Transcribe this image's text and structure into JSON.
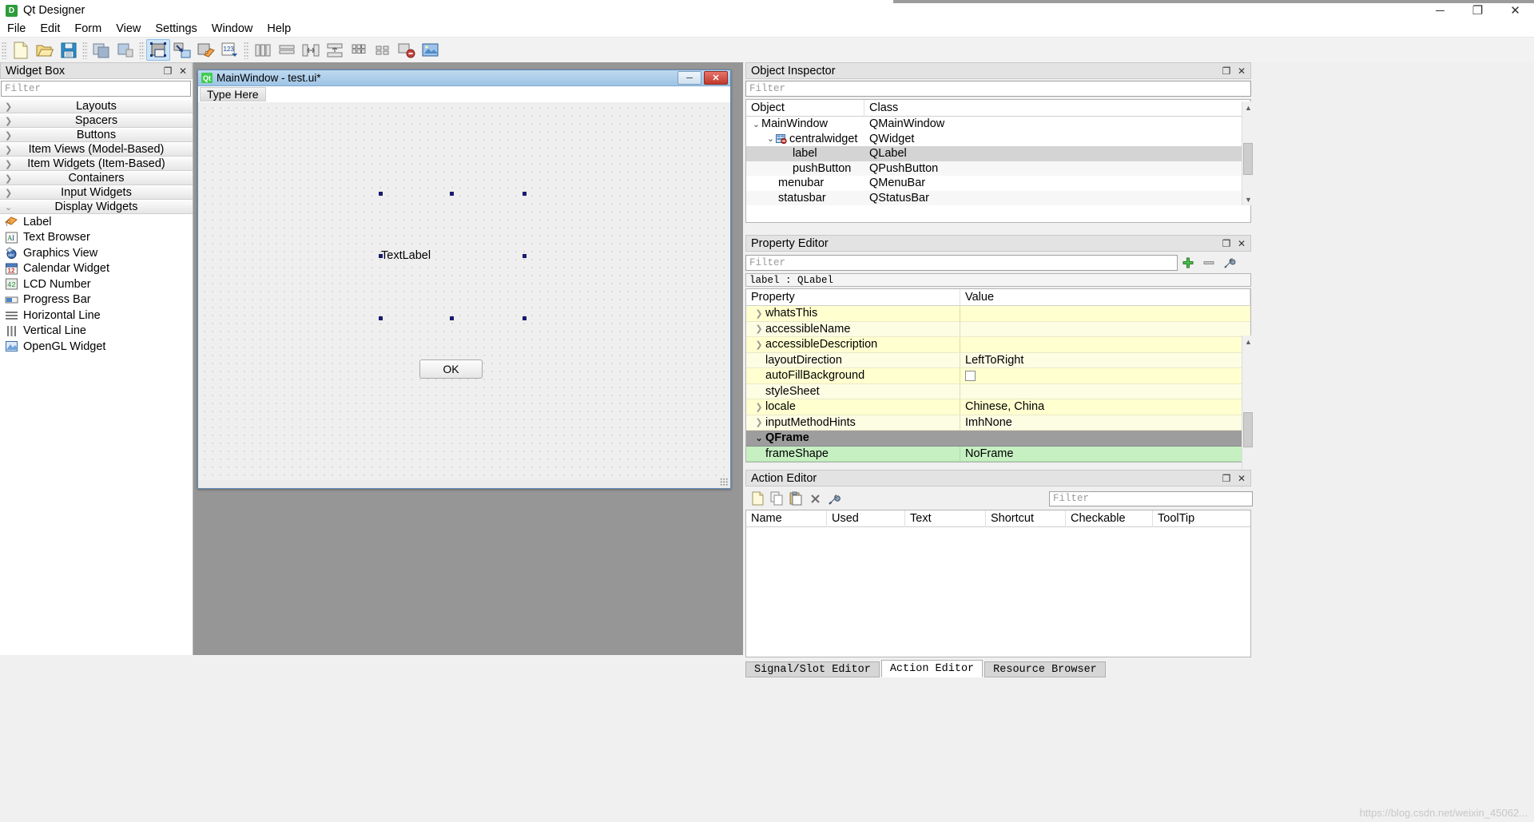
{
  "app": {
    "title": "Qt Designer",
    "icon": "qt-designer-icon",
    "window_buttons": {
      "minimize": "─",
      "maximize": "❐",
      "close": "✕"
    }
  },
  "menubar": {
    "items": [
      "File",
      "Edit",
      "Form",
      "View",
      "Settings",
      "Window",
      "Help"
    ]
  },
  "toolbar": {
    "groups": [
      {
        "name": "file",
        "buttons": [
          {
            "name": "new-form-button",
            "icon": "new-document-icon"
          },
          {
            "name": "open-form-button",
            "icon": "open-folder-icon"
          },
          {
            "name": "save-form-button",
            "icon": "floppy-save-icon"
          }
        ]
      },
      {
        "name": "edit",
        "buttons": [
          {
            "name": "undo-button",
            "icon": "copy-stack-icon"
          },
          {
            "name": "redo-button",
            "icon": "paste-stack-icon"
          }
        ]
      },
      {
        "name": "mode",
        "buttons": [
          {
            "name": "edit-widgets-button",
            "icon": "edit-widgets-icon",
            "active": true
          },
          {
            "name": "edit-signals-slots-button",
            "icon": "signal-slot-icon",
            "active": false
          },
          {
            "name": "edit-buddies-button",
            "icon": "buddy-label-icon",
            "active": false
          },
          {
            "name": "edit-tab-order-button",
            "icon": "tab-order-icon",
            "active": false
          }
        ]
      },
      {
        "name": "layout",
        "buttons": [
          {
            "name": "layout-horizontally-button",
            "icon": "layout-horizontal-icon"
          },
          {
            "name": "layout-vertically-button",
            "icon": "layout-vertical-icon"
          },
          {
            "name": "layout-splitter-h-button",
            "icon": "splitter-horizontal-icon"
          },
          {
            "name": "layout-splitter-v-button",
            "icon": "splitter-vertical-icon"
          },
          {
            "name": "layout-grid-button",
            "icon": "layout-grid-icon"
          },
          {
            "name": "layout-form-button",
            "icon": "layout-form-icon"
          },
          {
            "name": "break-layout-button",
            "icon": "break-layout-icon"
          },
          {
            "name": "adjust-size-button",
            "icon": "adjust-size-icon"
          }
        ]
      }
    ]
  },
  "widget_box": {
    "title": "Widget Box",
    "float_button": "❐",
    "close_button": "✕",
    "filter_placeholder": "Filter",
    "categories": [
      {
        "label": "Layouts",
        "expanded": false
      },
      {
        "label": "Spacers",
        "expanded": false
      },
      {
        "label": "Buttons",
        "expanded": false
      },
      {
        "label": "Item Views (Model-Based)",
        "expanded": false
      },
      {
        "label": "Item Widgets (Item-Based)",
        "expanded": false
      },
      {
        "label": "Containers",
        "expanded": false
      },
      {
        "label": "Input Widgets",
        "expanded": false
      },
      {
        "label": "Display Widgets",
        "expanded": true
      }
    ],
    "items": [
      {
        "label": "Label",
        "icon": "label-tag-icon"
      },
      {
        "label": "Text Browser",
        "icon": "text-browser-icon"
      },
      {
        "label": "Graphics View",
        "icon": "graphics-view-icon"
      },
      {
        "label": "Calendar Widget",
        "icon": "calendar-icon"
      },
      {
        "label": "LCD Number",
        "icon": "lcd-number-icon"
      },
      {
        "label": "Progress Bar",
        "icon": "progress-bar-icon"
      },
      {
        "label": "Horizontal Line",
        "icon": "horizontal-line-icon"
      },
      {
        "label": "Vertical Line",
        "icon": "vertical-line-icon"
      },
      {
        "label": "OpenGL Widget",
        "icon": "opengl-widget-icon"
      }
    ]
  },
  "form_window": {
    "title": "MainWindow - test.ui*",
    "icon": "qt-logo-icon",
    "buttons": {
      "minimize": "─",
      "close": "✕"
    },
    "menu_placeholder": "Type Here",
    "label_text": "TextLabel",
    "button_text": "OK"
  },
  "object_inspector": {
    "title": "Object Inspector",
    "float_button": "❐",
    "close_button": "✕",
    "filter_placeholder": "Filter",
    "columns": [
      "Object",
      "Class"
    ],
    "rows": [
      {
        "object": "MainWindow",
        "class": "QMainWindow",
        "depth": 0,
        "arrow": "⌄",
        "icon": "",
        "selected": false
      },
      {
        "object": "centralwidget",
        "class": "QWidget",
        "depth": 1,
        "arrow": "⌄",
        "icon": "central-widget-icon",
        "selected": false
      },
      {
        "object": "label",
        "class": "QLabel",
        "depth": 2,
        "arrow": "",
        "icon": "",
        "selected": true
      },
      {
        "object": "pushButton",
        "class": "QPushButton",
        "depth": 2,
        "arrow": "",
        "icon": "",
        "selected": false
      },
      {
        "object": "menubar",
        "class": "QMenuBar",
        "depth": 1,
        "arrow": "",
        "icon": "",
        "selected": false
      },
      {
        "object": "statusbar",
        "class": "QStatusBar",
        "depth": 1,
        "arrow": "",
        "icon": "",
        "selected": false
      }
    ]
  },
  "property_editor": {
    "title": "Property Editor",
    "float_button": "❐",
    "close_button": "✕",
    "filter_placeholder": "Filter",
    "add_button": "add-property-icon",
    "remove_button": "remove-property-icon",
    "configure_button": "configure-icon",
    "object_header": "label : QLabel",
    "columns": [
      "Property",
      "Value"
    ],
    "rows": [
      {
        "name": "whatsThis",
        "value": "",
        "expandable": true,
        "style": "y0"
      },
      {
        "name": "accessibleName",
        "value": "",
        "expandable": true,
        "style": "y1"
      },
      {
        "name": "accessibleDescription",
        "value": "",
        "expandable": true,
        "style": "y0"
      },
      {
        "name": "layoutDirection",
        "value": "LeftToRight",
        "expandable": false,
        "style": "y1"
      },
      {
        "name": "autoFillBackground",
        "value": "",
        "expandable": false,
        "style": "y0",
        "checkbox": true
      },
      {
        "name": "styleSheet",
        "value": "",
        "expandable": false,
        "style": "y1"
      },
      {
        "name": "locale",
        "value": "Chinese, China",
        "expandable": true,
        "style": "y0"
      },
      {
        "name": "inputMethodHints",
        "value": "ImhNone",
        "expandable": true,
        "style": "y1"
      },
      {
        "name": "QFrame",
        "value": "",
        "expandable": true,
        "style": "group"
      },
      {
        "name": "frameShape",
        "value": "NoFrame",
        "expandable": false,
        "style": "green"
      }
    ]
  },
  "action_editor": {
    "title": "Action Editor",
    "float_button": "❐",
    "close_button": "✕",
    "filter_placeholder": "Filter",
    "toolbar_buttons": [
      {
        "name": "new-action-button",
        "icon": "new-action-icon"
      },
      {
        "name": "copy-action-button",
        "icon": "copy-icon"
      },
      {
        "name": "paste-action-button",
        "icon": "paste-icon"
      },
      {
        "name": "delete-action-button",
        "icon": "delete-x-icon"
      },
      {
        "name": "edit-action-button",
        "icon": "wrench-icon"
      }
    ],
    "columns": [
      "Name",
      "Used",
      "Text",
      "Shortcut",
      "Checkable",
      "ToolTip"
    ],
    "rows": []
  },
  "bottom_tabs": {
    "tabs": [
      {
        "label": "Signal/Slot Editor",
        "active": false
      },
      {
        "label": "Action Editor",
        "active": true
      },
      {
        "label": "Resource Browser",
        "active": false
      }
    ]
  },
  "watermark": "https://blog.csdn.net/weixin_45062..."
}
